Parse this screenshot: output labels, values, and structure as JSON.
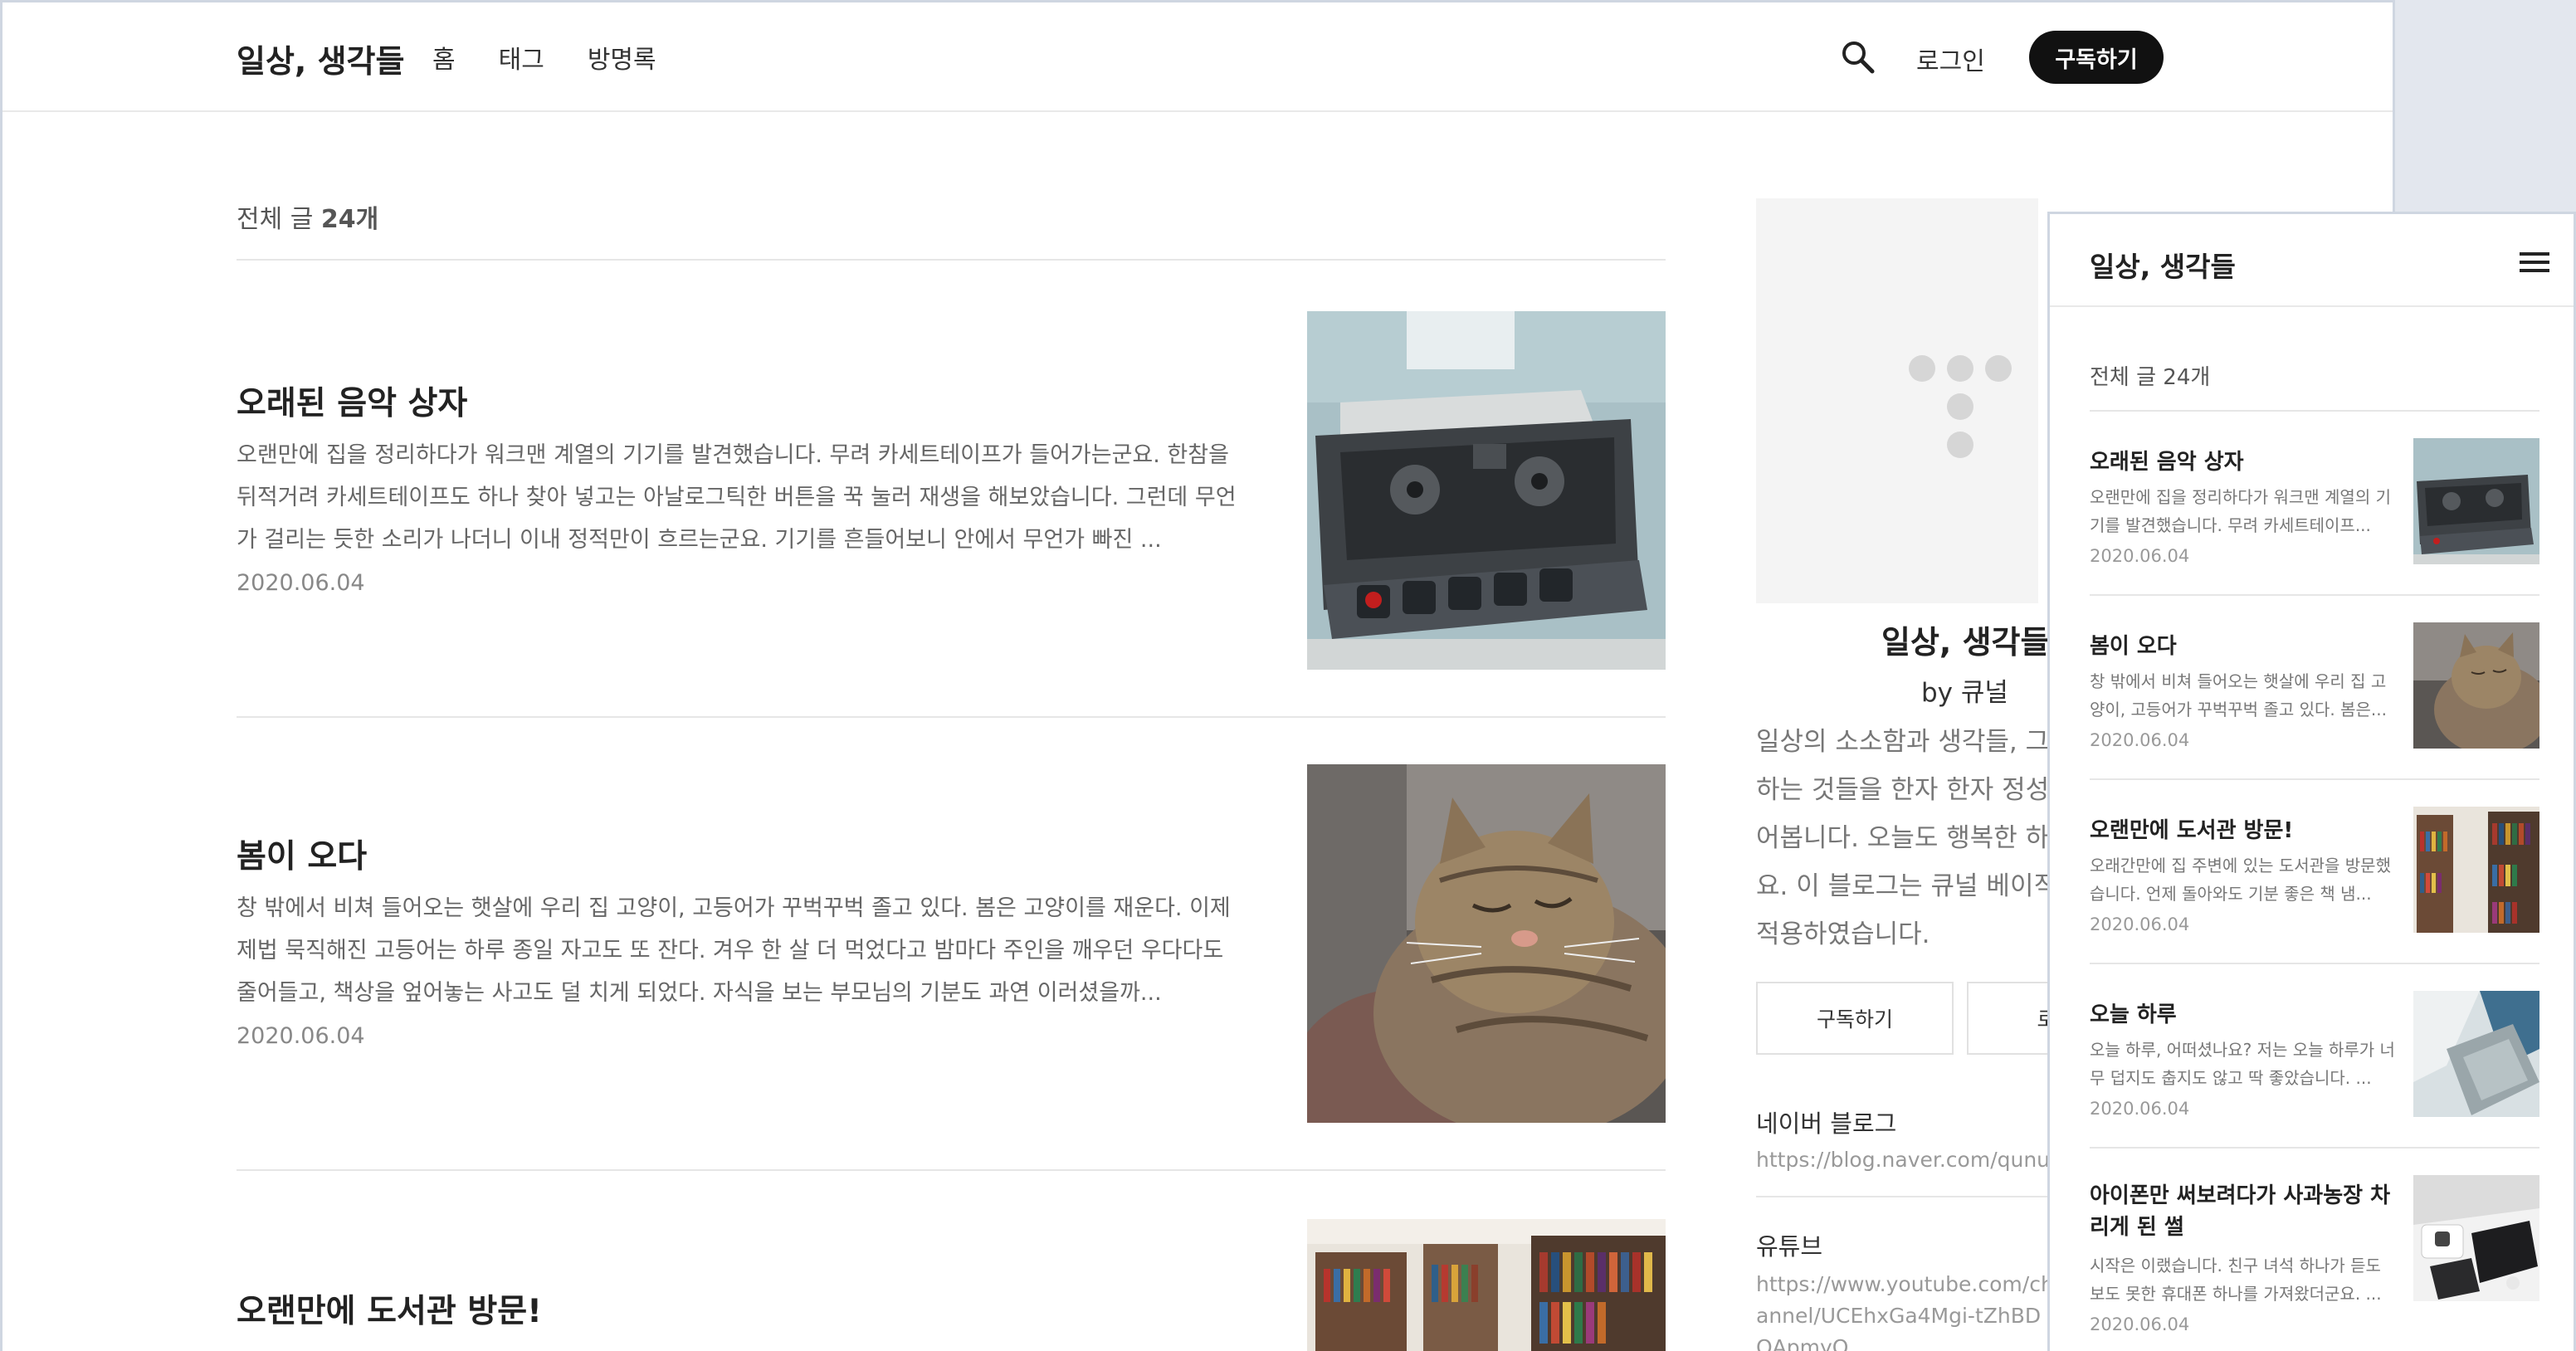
{
  "header": {
    "brand": "일상, 생각들",
    "nav": [
      "홈",
      "태그",
      "방명록"
    ],
    "login": "로그인",
    "subscribe": "구독하기"
  },
  "list": {
    "count_prefix": "전체 글 ",
    "count_value": "24개"
  },
  "posts": [
    {
      "title": "오래된 음악 상자",
      "excerpt": "오랜만에 집을 정리하다가 워크맨 계열의 기기를 발견했습니다. 무려 카세트테이프가 들어가는군요. 한참을 뒤적거려 카세트테이프도 하나 찾아 넣고는 아날로그틱한 버튼을 꾹 눌러 재생을 해보았습니다. 그런데 무언가 걸리는 듯한 소리가 나더니 이내 정적만이 흐르는군요. 기기를 흔들어보니 안에서 무언가 빠진 ...",
      "date": "2020.06.04",
      "image": "cassette-player-photo"
    },
    {
      "title": "봄이 오다",
      "excerpt": "창 밖에서 비쳐 들어오는 햇살에 우리 집 고양이, 고등어가 꾸벅꾸벅 졸고 있다. 봄은 고양이를 재운다. 이제 제법 묵직해진 고등어는 하루 종일 자고도 또 잔다. 겨우 한 살 더 먹었다고 밤마다 주인을 깨우던 우다다도 줄어들고, 책상을 엎어놓는 사고도 덜 치게 되었다. 자식을 보는 부모님의 기분도 과연 이러셨을까...",
      "date": "2020.06.04",
      "image": "sleeping-cat-photo"
    },
    {
      "title": "오랜만에 도서관 방문!",
      "excerpt": "",
      "date": "",
      "image": "library-photo"
    }
  ],
  "sidebar": {
    "blog_name": "일상, 생각들",
    "author": "by 큐널",
    "description": "일상의 소소함과 생각들, 그리고 기록하는 것들을 한자 한자 정성 들여 적어봅니다. 오늘도 행복한 하루 보내세요. 이 블로그는 큐널 베이직 스킨을 적용하였습니다.",
    "subscribe": "구독하기",
    "second_button": "로그인",
    "links": [
      {
        "label": "네이버 블로그",
        "url": "https://blog.naver.com/qunul"
      },
      {
        "label": "유튜브",
        "url": "https://www.youtube.com/channel/UCEhxGa4Mgi-tZhBDQApmyQ"
      }
    ]
  },
  "mobile": {
    "brand": "일상, 생각들",
    "count": "전체 글 24개",
    "posts": [
      {
        "title": "오래된 음악 상자",
        "excerpt": "오랜만에 집을 정리하다가 워크맨 계열의 기기를 발견했습니다. 무려 카세트테이프...",
        "date": "2020.06.04"
      },
      {
        "title": "봄이 오다",
        "excerpt": "창 밖에서 비쳐 들어오는 햇살에 우리 집 고양이, 고등어가 꾸벅꾸벅 졸고 있다. 봄은...",
        "date": "2020.06.04"
      },
      {
        "title": "오랜만에 도서관 방문!",
        "excerpt": "오래간만에 집 주변에 있는 도서관을 방문했습니다. 언제 돌아와도 기분 좋은 책 냄...",
        "date": "2020.06.04"
      },
      {
        "title": "오늘 하루",
        "excerpt": "오늘 하루, 어떠셨나요? 저는 오늘 하루가 너무 덥지도 춥지도 않고 딱 좋았습니다. ...",
        "date": "2020.06.04"
      },
      {
        "title": "아이폰만 써보려다가 사과농장 차리게 된 썰",
        "excerpt": "시작은 이랬습니다. 친구 녀석 하나가 듣도 보도 못한 휴대폰 하나를 가져왔더군요. ...",
        "date": "2020.06.04"
      }
    ]
  },
  "colors": {
    "accent": "#111111",
    "text": "#222222",
    "muted": "#777777",
    "rule": "#e6e6e6"
  }
}
